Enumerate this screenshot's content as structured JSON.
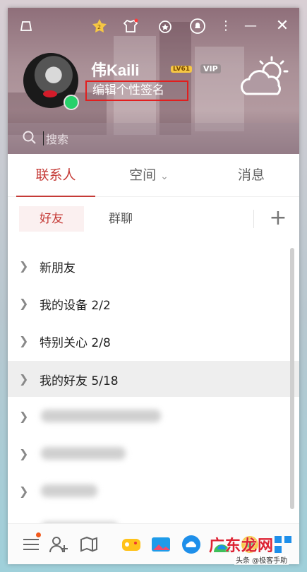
{
  "header": {
    "nickname": "伟Kaili",
    "level_badge": "LV61",
    "vip_badge": "VIP",
    "signature": "编辑个性签名",
    "search_placeholder": "搜索",
    "top_icons": [
      "drive-icon",
      "medal-icon",
      "shirt-icon",
      "badge-icon",
      "bell-icon",
      "more-icon",
      "minimize-icon",
      "close-icon"
    ]
  },
  "tabs": [
    "联系人",
    "空间",
    "消息"
  ],
  "subtabs": [
    "好友",
    "群聊"
  ],
  "add_button": "+",
  "groups": [
    {
      "label": "新朋友"
    },
    {
      "label": "我的设备 2/2"
    },
    {
      "label": "特别关心 2/8"
    },
    {
      "label": "我的好友 5/18"
    }
  ],
  "blurred_group_count_note": "",
  "bottom_icons": [
    "menu-icon",
    "add-friend-icon",
    "files-icon",
    "game-icon",
    "image-icon",
    "weather-cloud-icon",
    "app-icon",
    "flower-icon",
    "apps-grid-icon"
  ],
  "watermark": {
    "big": "广东龙网",
    "small": "头条 @极客手助"
  },
  "colors": {
    "accent": "#c53a36",
    "online": "#28d16b"
  }
}
